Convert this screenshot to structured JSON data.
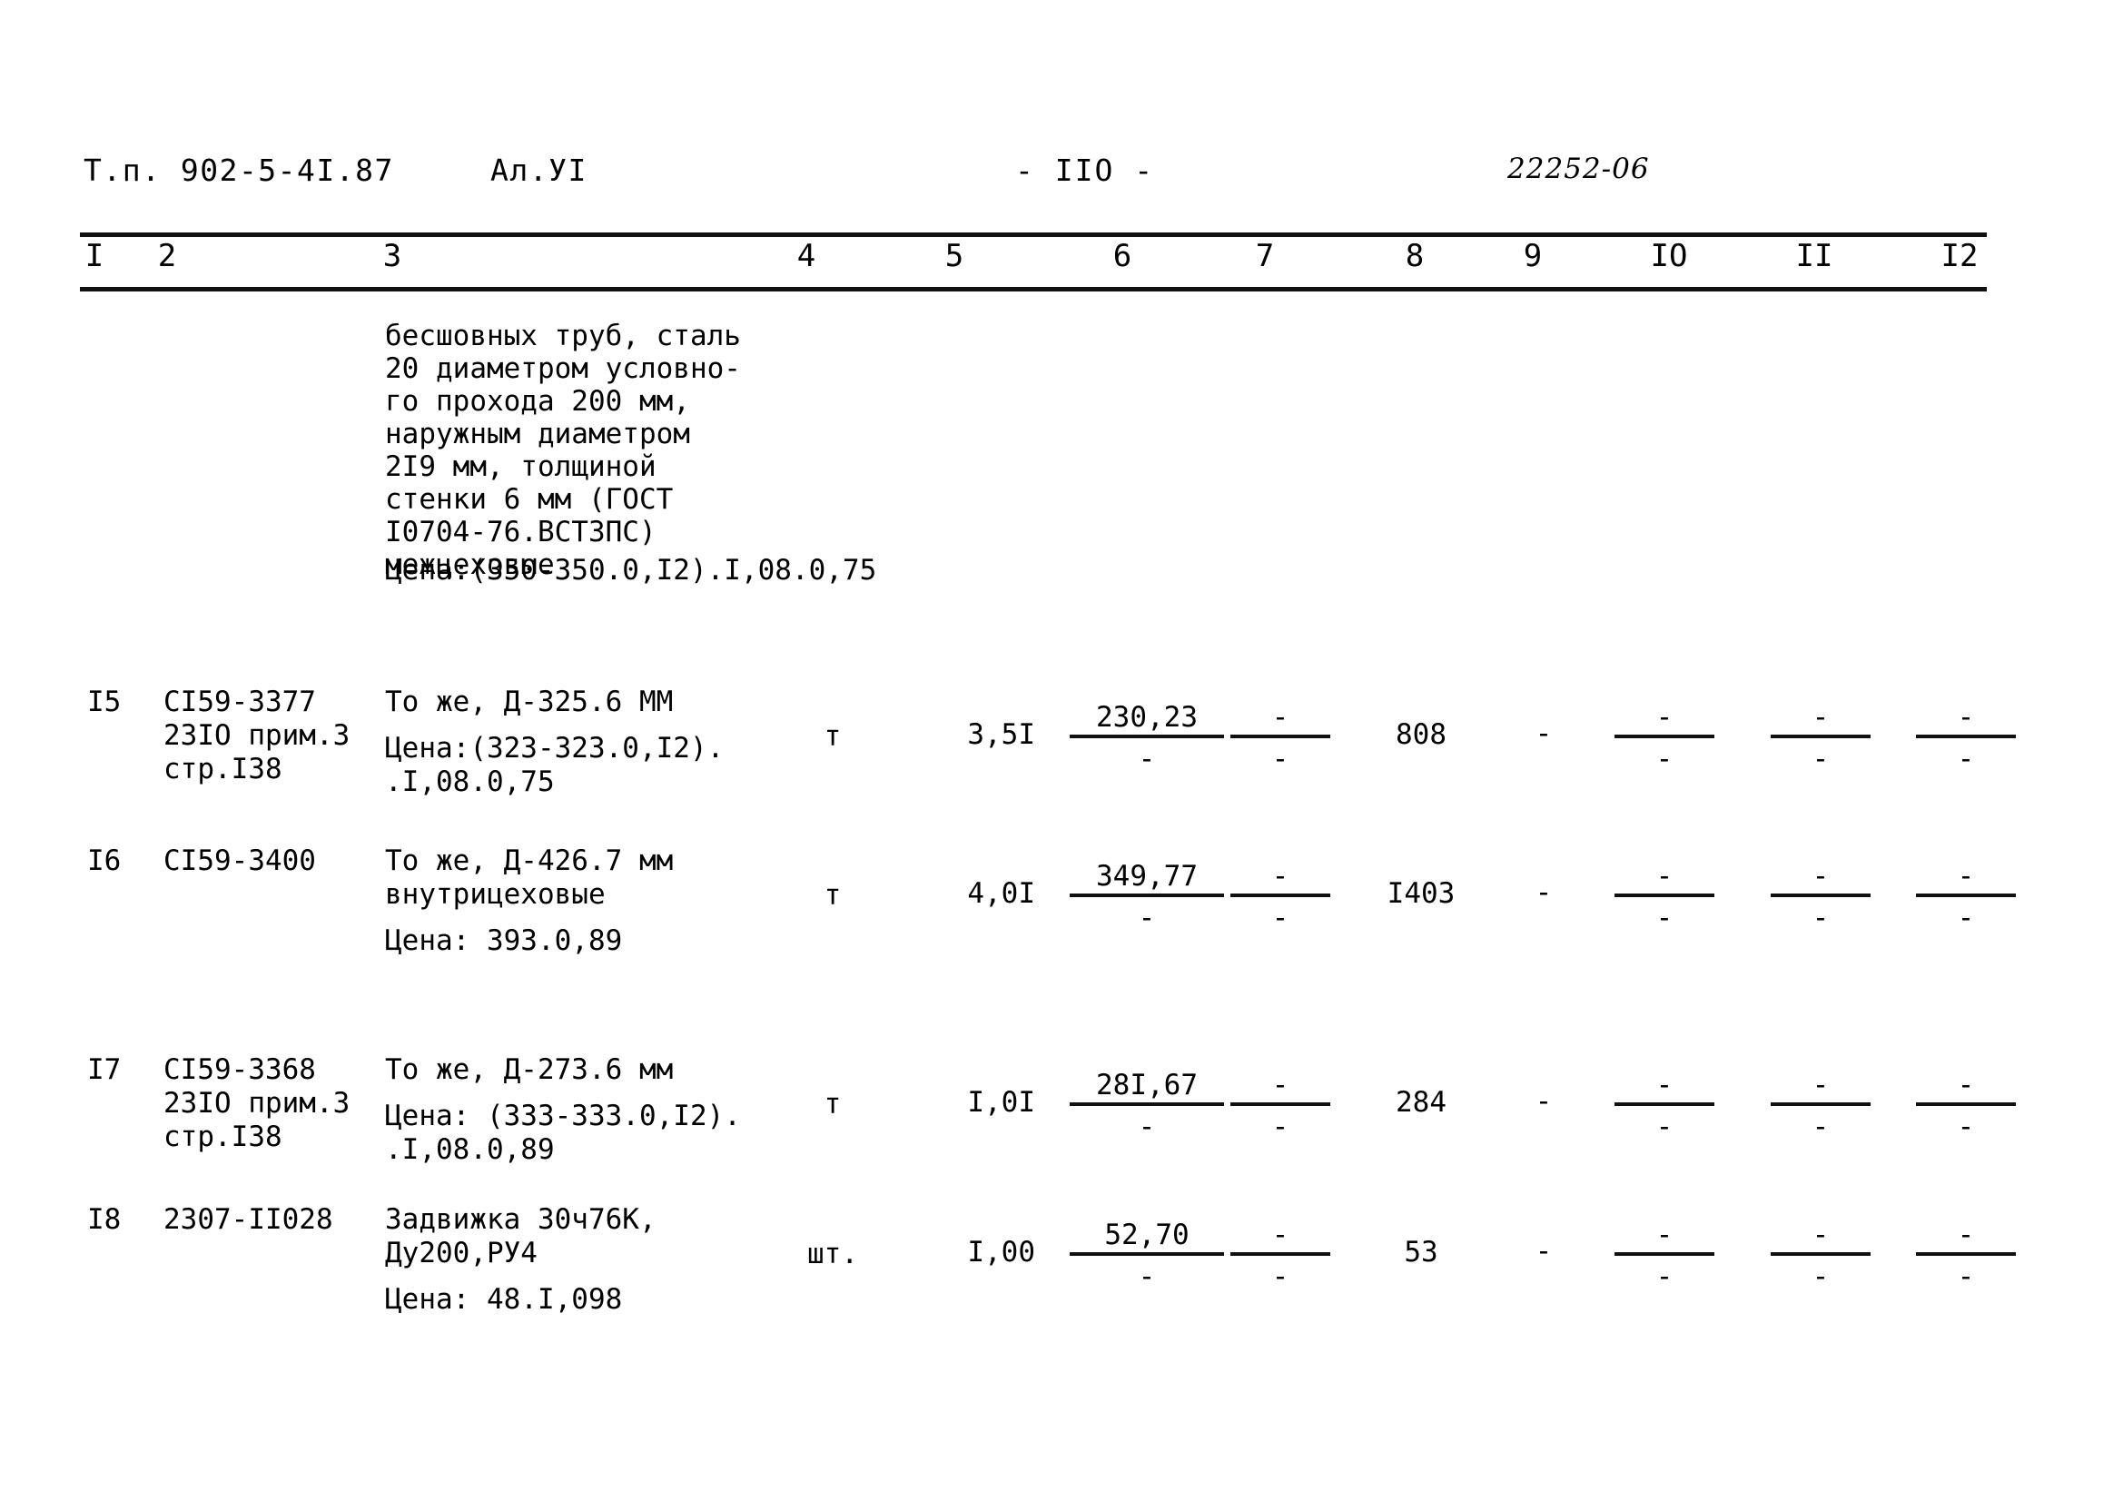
{
  "header": {
    "project_code": "Т.п. 902-5-4I.87",
    "album": "Ал.УI",
    "page_number": "- IIO -",
    "doc_code": "22252-06"
  },
  "table": {
    "column_numbers": [
      "I",
      "2",
      "3",
      "4",
      "5",
      "6",
      "7",
      "8",
      "9",
      "IO",
      "II",
      "I2"
    ],
    "intro_block": {
      "description": "бесшовных труб, сталь\n20 диаметром условно-\nго прохода 200 мм,\nнаружным диаметром\n2I9 мм, толщиной\nстенки 6 мм (ГОСТ\nI0704-76.ВСТ3ПС)\nмежцеховые",
      "price": "Цена:(350-350.0,I2).I,08.0,75"
    },
    "rows": [
      {
        "num": "I5",
        "code": "CI59-3377\n23IO прим.3\nстр.I38",
        "description": "То же, Д-325.6 ММ",
        "price": "Цена:(323-323.0,I2).\n       .I,08.0,75",
        "unit": "т",
        "quantity": "3,5I",
        "col6_top": "230,23",
        "col6_bottom": "-",
        "col7_top": "-",
        "col7_bottom": "-",
        "col8": "808",
        "col9": "-",
        "col10_top": "-",
        "col10_bottom": "-",
        "col11_top": "-",
        "col11_bottom": "-",
        "col12_top": "-",
        "col12_bottom": "-"
      },
      {
        "num": "I6",
        "code": "CI59-3400",
        "description": "То же, Д-426.7 мм\nвнутрицеховые",
        "price": "Цена:  393.0,89",
        "unit": "т",
        "quantity": "4,0I",
        "col6_top": "349,77",
        "col6_bottom": "-",
        "col7_top": "-",
        "col7_bottom": "-",
        "col8": "I403",
        "col9": "-",
        "col10_top": "-",
        "col10_bottom": "-",
        "col11_top": "-",
        "col11_bottom": "-",
        "col12_top": "-",
        "col12_bottom": "-"
      },
      {
        "num": "I7",
        "code": "CI59-3368\n23IO прим.3\nстр.I38",
        "description": "То же, Д-273.6 мм",
        "price": "Цена: (333-333.0,I2).\n        .I,08.0,89",
        "unit": "т",
        "quantity": "I,0I",
        "col6_top": "28I,67",
        "col6_bottom": "-",
        "col7_top": "-",
        "col7_bottom": "-",
        "col8": "284",
        "col9": "-",
        "col10_top": "-",
        "col10_bottom": "-",
        "col11_top": "-",
        "col11_bottom": "-",
        "col12_top": "-",
        "col12_bottom": "-"
      },
      {
        "num": "I8",
        "code": "2307-II028",
        "description": "Задвижка 30ч76К,\nДу200,РУ4",
        "price": "Цена: 48.I,098",
        "unit": "шт.",
        "quantity": "I,00",
        "col6_top": "52,70",
        "col6_bottom": "-",
        "col7_top": "-",
        "col7_bottom": "-",
        "col8": "53",
        "col9": "-",
        "col10_top": "-",
        "col10_bottom": "-",
        "col11_top": "-",
        "col11_bottom": "-",
        "col12_top": "-",
        "col12_bottom": "-"
      }
    ]
  }
}
